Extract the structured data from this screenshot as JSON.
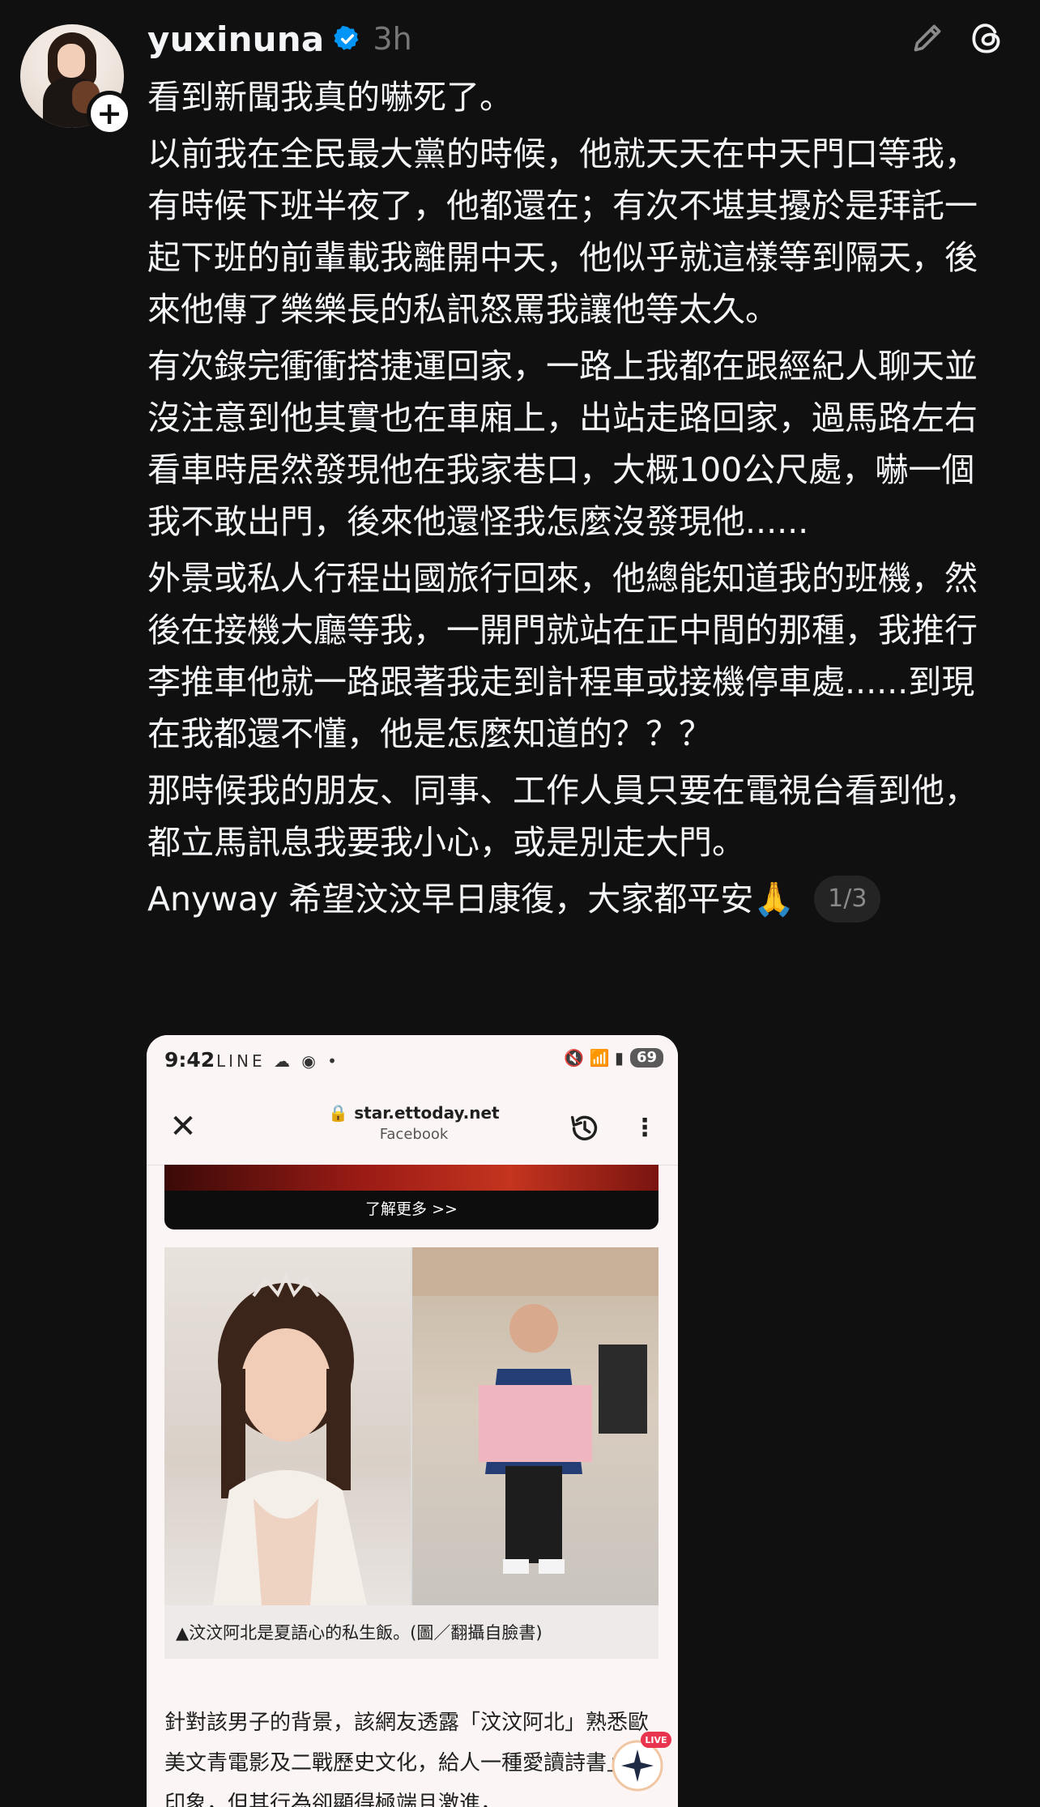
{
  "header": {
    "username": "yuxinuna",
    "time": "3h",
    "verified_color": "#0095f6"
  },
  "icons": {
    "avatar": "profile-photo",
    "follow": "plus-icon",
    "verified": "verified-badge-icon",
    "edit": "pencil-icon",
    "threads": "threads-logo-icon"
  },
  "post": {
    "paragraphs": [
      "看到新聞我真的嚇死了。",
      "以前我在全民最大黨的時候，他就天天在中天門口等我，有時候下班半夜了，他都還在；有次不堪其擾於是拜託一起下班的前輩載我離開中天，他似乎就這樣等到隔天，後來他傳了樂樂長的私訊怒罵我讓他等太久。",
      "有次錄完衝衝搭捷運回家，一路上我都在跟經紀人聊天並沒注意到他其實也在車廂上，出站走路回家，過馬路左右看車時居然發現他在我家巷口，大概100公尺處，嚇一個我不敢出門，後來他還怪我怎麼沒發現他......",
      "外景或私人行程出國旅行回來，他總能知道我的班機，然後在接機大廳等我，一開門就站在正中間的那種，我推行李推車他就一路跟著我走到計程車或接機停車處......到現在我都還不懂，他是怎麼知道的？？？",
      "那時候我的朋友、同事、工作人員只要在電視台看到他，都立馬訊息我要我小心，或是別走大門。"
    ],
    "last_line": "Anyway 希望汶汶早日康復，大家都平安🙏",
    "page_indicator": "1/3"
  },
  "screenshot": {
    "status_time": "9:42",
    "status_left_icons": "LINE ☁ ◉ •",
    "status_right_icons": "🔇 📶 ▮",
    "battery": "69",
    "url": "star.ettoday.net",
    "url_sub": "Facebook",
    "ad_button": "了解更多 >>",
    "caption": "▲汶汶阿北是夏語心的私生飯。(圖／翻攝自臉書)",
    "body": "針對該男子的背景，該網友透露「汶汶阿北」熟悉歐美文青電影及二戰歷史文化，給人一種愛讀詩書」的印象，但其行為卻顯得極端且激進，",
    "live_label": "LIVE"
  }
}
